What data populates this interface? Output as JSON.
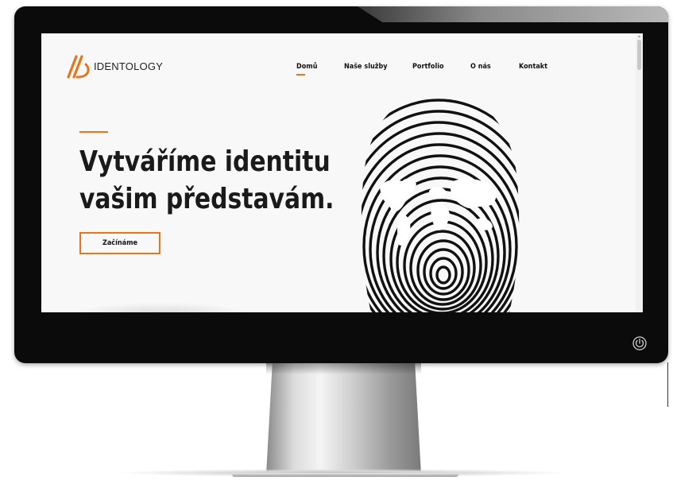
{
  "brand": {
    "name": "IDENTOLOGY",
    "accent_color": "#e8751a"
  },
  "nav": {
    "items": [
      {
        "label": "Domů",
        "active": true
      },
      {
        "label": "Naše služby"
      },
      {
        "label": "Portfolio"
      },
      {
        "label": "O nás"
      },
      {
        "label": "Kontakt"
      }
    ]
  },
  "hero": {
    "title_line1": "Vytváříme identitu",
    "title_line2": "vašim představám.",
    "cta_label": "Začínáme",
    "image": "fingerprint-world-map"
  },
  "device": {
    "type": "desktop-monitor",
    "power_icon": "power-icon"
  }
}
